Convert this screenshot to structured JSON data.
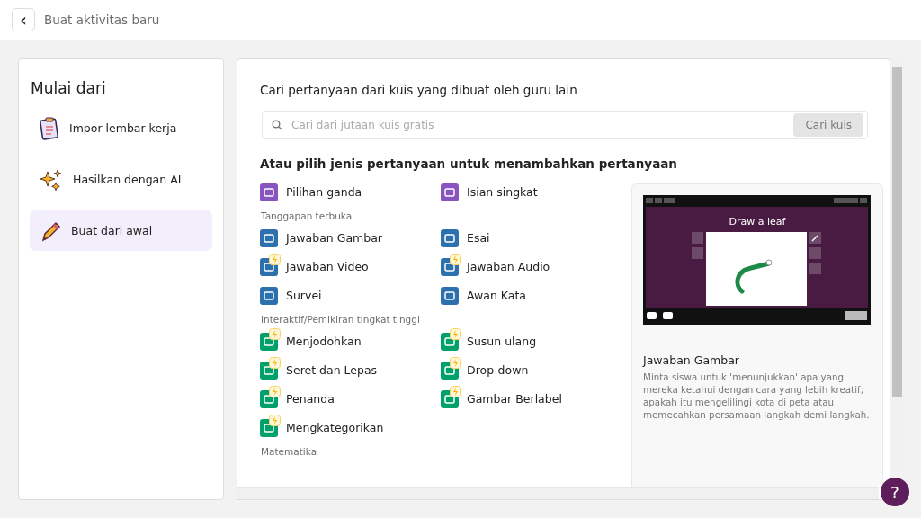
{
  "header": {
    "back": "‹",
    "title": "Buat aktivitas baru"
  },
  "sidebar": {
    "title": "Mulai dari",
    "items": [
      {
        "label": "Impor lembar kerja",
        "kind": "clipboard",
        "selected": false
      },
      {
        "label": "Hasilkan dengan AI",
        "kind": "sparkle",
        "selected": false
      },
      {
        "label": "Buat dari awal",
        "kind": "pencil",
        "selected": true
      }
    ]
  },
  "search": {
    "title": "Cari pertanyaan dari kuis yang dibuat oleh guru lain",
    "placeholder": "Cari dari jutaan kuis gratis",
    "button": "Cari kuis"
  },
  "types_heading": "Atau pilih jenis pertanyaan untuk menambahkan pertanyaan",
  "sections": [
    {
      "items": [
        {
          "label": "Pilihan ganda",
          "color": "#8854c0",
          "premium": false
        },
        {
          "label": "Isian singkat",
          "color": "#8854c0",
          "premium": false
        }
      ]
    },
    {
      "title": "Tanggapan terbuka",
      "items": [
        {
          "label": "Jawaban Gambar",
          "color": "#2d70ae",
          "premium": false
        },
        {
          "label": "Esai",
          "color": "#2d70ae",
          "premium": false
        },
        {
          "label": "Jawaban Video",
          "color": "#2d70ae",
          "premium": true
        },
        {
          "label": "Jawaban Audio",
          "color": "#2d70ae",
          "premium": true
        },
        {
          "label": "Survei",
          "color": "#2d70ae",
          "premium": false
        },
        {
          "label": "Awan Kata",
          "color": "#2d70ae",
          "premium": false
        }
      ]
    },
    {
      "title": "Interaktif/Pemikiran tingkat tinggi",
      "items": [
        {
          "label": "Menjodohkan",
          "color": "#00a06a",
          "premium": true
        },
        {
          "label": "Susun ulang",
          "color": "#00a06a",
          "premium": true
        },
        {
          "label": "Seret dan Lepas",
          "color": "#00a06a",
          "premium": true
        },
        {
          "label": "Drop-down",
          "color": "#00a06a",
          "premium": true
        },
        {
          "label": "Penanda",
          "color": "#00a06a",
          "premium": true
        },
        {
          "label": "Gambar Berlabel",
          "color": "#00a06a",
          "premium": true
        },
        {
          "label": "Mengkategorikan",
          "color": "#00a06a",
          "premium": true
        }
      ]
    },
    {
      "title": "Matematika"
    }
  ],
  "preview": {
    "screen_title": "Draw a leaf",
    "title": "Jawaban Gambar",
    "description": "Minta siswa untuk 'menunjukkan' apa yang mereka ketahui dengan cara yang lebih kreatif; apakah itu mengelilingi kota di peta atau memecahkan persamaan langkah demi langkah."
  },
  "help": "?"
}
